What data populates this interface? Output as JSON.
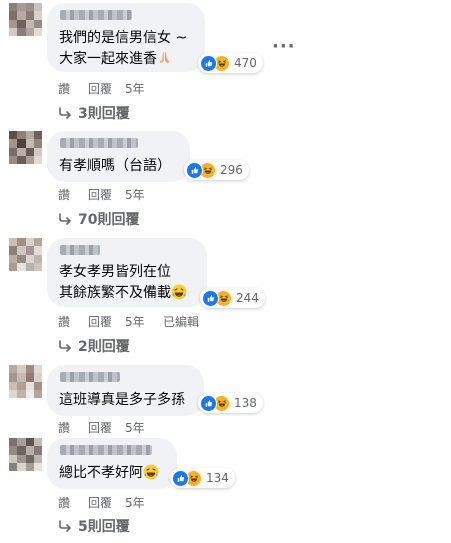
{
  "comments": [
    {
      "text_lines": [
        "我們的是信男信女 ~",
        "大家一起來進香"
      ],
      "trailing_emoji": "pray-emoji",
      "reaction_count": "470",
      "actions": {
        "read": "讚",
        "reply": "回覆",
        "time": "5年"
      },
      "replies": "3則回覆"
    },
    {
      "text_lines": [
        "有孝順嗎（台語）"
      ],
      "reaction_count": "296",
      "actions": {
        "read": "讚",
        "reply": "回覆",
        "time": "5年"
      },
      "replies": "70則回覆"
    },
    {
      "text_lines": [
        "孝女孝男皆列在位",
        "其餘族繁不及備載"
      ],
      "trailing_emoji": "laughing-emoji",
      "reaction_count": "244",
      "actions": {
        "read": "讚",
        "reply": "回覆",
        "time": "5年",
        "edited": "已編輯"
      },
      "replies": "2則回覆"
    },
    {
      "text_lines": [
        "這班導真是多子多孫"
      ],
      "reaction_count": "138",
      "actions": {
        "read": "讚",
        "reply": "回覆",
        "time": "5年"
      }
    },
    {
      "text_lines": [
        "總比不孝好阿"
      ],
      "trailing_emoji": "laughing-emoji",
      "reaction_count": "134",
      "actions": {
        "read": "讚",
        "reply": "回覆",
        "time": "5年"
      },
      "replies": "5則回覆"
    }
  ],
  "icons": {
    "more": "more-options-icon",
    "reply_arrow": "reply-arrow-icon",
    "like": "like-reaction-icon",
    "haha": "haha-reaction-icon"
  },
  "colors": {
    "bubble": "#f0f2f5",
    "secondary_text": "#65676b",
    "like_blue": "#1877f2",
    "haha_yellow": "#f7b125"
  }
}
